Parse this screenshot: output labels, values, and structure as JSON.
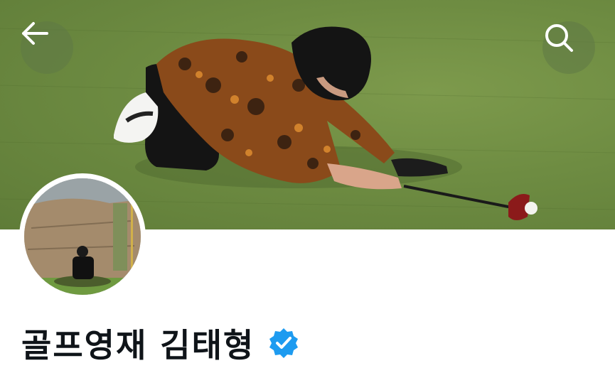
{
  "header": {
    "back_icon": "arrow-left-icon",
    "search_icon": "search-icon"
  },
  "banner": {
    "description_icon": "golf-green-photo"
  },
  "profile": {
    "display_name": "골프영재 김태형",
    "verified_icon": "verified-badge-icon",
    "verified_color": "#1d9bf0"
  }
}
